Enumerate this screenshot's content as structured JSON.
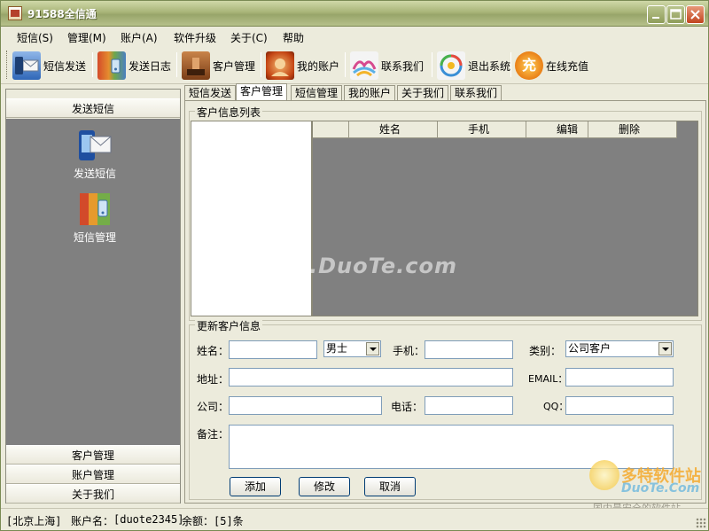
{
  "window": {
    "title": "91588全信通"
  },
  "menu": [
    "短信(S)",
    "管理(M)",
    "账户(A)",
    "软件升级",
    "关于(C)",
    "帮助"
  ],
  "toolbar": [
    {
      "label": "短信发送",
      "icon": "envelope-phone-icon"
    },
    {
      "label": "发送日志",
      "icon": "log-book-icon"
    },
    {
      "label": "客户管理",
      "icon": "customer-icon"
    },
    {
      "label": "我的账户",
      "icon": "account-icon"
    },
    {
      "label": "联系我们",
      "icon": "contact-icon"
    },
    {
      "label": "退出系统",
      "icon": "exit-icon"
    },
    {
      "label": "在线充值",
      "icon": "recharge-icon",
      "glyph": "充"
    }
  ],
  "sidebar": {
    "header": "发送短信",
    "icons": [
      {
        "label": "发送短信",
        "icon": "send-sms-icon"
      },
      {
        "label": "短信管理",
        "icon": "sms-manage-icon"
      }
    ],
    "footer": [
      "客户管理",
      "账户管理",
      "关于我们"
    ]
  },
  "tabs": [
    "短信发送",
    "客户管理",
    "短信管理",
    "我的账户",
    "关于我们",
    "联系我们"
  ],
  "active_tab": "客户管理",
  "customer_list": {
    "title": "客户信息列表",
    "columns": [
      "姓名",
      "手机",
      "编辑",
      "删除"
    ],
    "rows": []
  },
  "form": {
    "title": "更新客户信息",
    "name_label": "姓名：",
    "gender_value": "男士",
    "phone_label": "手机：",
    "category_label": "类别：",
    "category_value": "公司客户",
    "address_label": "地址：",
    "email_label": "EMAIL：",
    "company_label": "公司：",
    "tel_label": "电话：",
    "qq_label": "QQ：",
    "note_label": "备注：",
    "add_label": "添加",
    "edit_label": "修改",
    "cancel_label": "取消"
  },
  "status": {
    "location": "[北京上海]",
    "account_label": "账户名：",
    "account_value": "[duote2345]",
    "balance_label": "余额：",
    "balance_value": "[5]条"
  },
  "overlay": {
    "watermark": "www.DuoTe.com",
    "brand_cn": "多特软件站",
    "brand_en": "DuoTe.Com",
    "slogan": "国内最安全的软件站"
  },
  "colors": {
    "titlebar": "#a9b579",
    "panel_gray": "#808080",
    "accent_orange": "#f5a623"
  }
}
